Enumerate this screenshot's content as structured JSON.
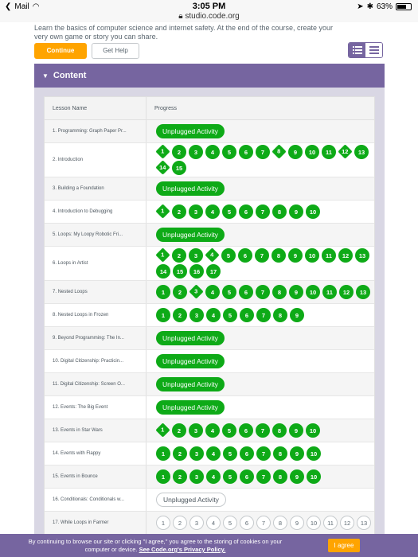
{
  "status_bar": {
    "back_label": "Mail",
    "time": "3:05 PM",
    "url": "studio.code.org",
    "battery": "63%"
  },
  "intro": {
    "description": "Learn the basics of computer science and internet safety. At the end of the course, create your very own game or story you can share."
  },
  "buttons": {
    "continue": "Continue",
    "help": "Get Help"
  },
  "section": {
    "title": "Content"
  },
  "table": {
    "col_name": "Lesson Name",
    "col_progress": "Progress",
    "rows": [
      {
        "name": "1. Programming: Graph Paper Pr...",
        "type": "pill",
        "label": "Unplugged Activity",
        "filled": true,
        "h": 29
      },
      {
        "name": "2. Introduction",
        "type": "levels",
        "levels": [
          "1",
          "2",
          "3",
          "4",
          "5",
          "6",
          "7",
          "8",
          "9",
          "10",
          "11",
          "12",
          "13",
          "14",
          "15"
        ],
        "diamonds": [
          0,
          7,
          11,
          13
        ],
        "filled": true,
        "h": 43
      },
      {
        "name": "3. Building a Foundation",
        "type": "pill",
        "label": "Unplugged Activity",
        "filled": true,
        "h": 29
      },
      {
        "name": "4. Introduction to Debugging",
        "type": "levels",
        "levels": [
          "1",
          "2",
          "3",
          "4",
          "5",
          "6",
          "7",
          "8",
          "9",
          "10"
        ],
        "diamonds": [
          0
        ],
        "filled": true,
        "h": 29
      },
      {
        "name": "5. Loops: My Loopy Robotic Fri...",
        "type": "pill",
        "label": "Unplugged Activity",
        "filled": true,
        "h": 29
      },
      {
        "name": "6. Loops in Artist",
        "type": "levels",
        "levels": [
          "1",
          "2",
          "3",
          "4",
          "5",
          "6",
          "7",
          "8",
          "9",
          "10",
          "11",
          "12",
          "13",
          "14",
          "15",
          "16",
          "17"
        ],
        "diamonds": [
          0,
          3
        ],
        "filled": true,
        "h": 43
      },
      {
        "name": "7. Nested Loops",
        "type": "levels",
        "levels": [
          "1",
          "2",
          "3",
          "4",
          "5",
          "6",
          "7",
          "8",
          "9",
          "10",
          "11",
          "12",
          "13"
        ],
        "diamonds": [
          2
        ],
        "filled": true,
        "h": 29
      },
      {
        "name": "8. Nested Loops in Frozen",
        "type": "levels",
        "levels": [
          "1",
          "2",
          "3",
          "4",
          "5",
          "6",
          "7",
          "8",
          "9"
        ],
        "diamonds": [],
        "filled": true,
        "h": 29
      },
      {
        "name": "9. Beyond Programming: The In...",
        "type": "pill",
        "label": "Unplugged Activity",
        "filled": true,
        "h": 29
      },
      {
        "name": "10. Digital Citizenship: Practicin...",
        "type": "pill",
        "label": "Unplugged Activity",
        "filled": true,
        "h": 29
      },
      {
        "name": "11. Digital Citizenship: Screen O...",
        "type": "pill",
        "label": "Unplugged Activity",
        "filled": true,
        "h": 29
      },
      {
        "name": "12. Events: The Big Event",
        "type": "pill",
        "label": "Unplugged Activity",
        "filled": true,
        "h": 29
      },
      {
        "name": "13. Events in Star Wars",
        "type": "levels",
        "levels": [
          "1",
          "2",
          "3",
          "4",
          "5",
          "6",
          "7",
          "8",
          "9",
          "10"
        ],
        "diamonds": [
          0
        ],
        "filled": true,
        "h": 29
      },
      {
        "name": "14. Events with Flappy",
        "type": "levels",
        "levels": [
          "1",
          "2",
          "3",
          "4",
          "5",
          "6",
          "7",
          "8",
          "9",
          "10"
        ],
        "diamonds": [],
        "filled": true,
        "h": 29
      },
      {
        "name": "15. Events in Bounce",
        "type": "levels",
        "levels": [
          "1",
          "2",
          "3",
          "4",
          "5",
          "6",
          "7",
          "8",
          "9",
          "10"
        ],
        "diamonds": [],
        "filled": true,
        "h": 29
      },
      {
        "name": "16. Conditionals: Conditionals w...",
        "type": "pill",
        "label": "Unplugged Activity",
        "filled": false,
        "h": 29
      },
      {
        "name": "17. While Loops in Farmer",
        "type": "levels",
        "levels": [
          "1",
          "2",
          "3",
          "4",
          "5",
          "6",
          "7",
          "8",
          "9",
          "10",
          "11",
          "12",
          "13"
        ],
        "diamonds": [],
        "filled": false,
        "h": 29
      }
    ]
  },
  "cookie": {
    "text_line1": "By continuing to browse our site or clicking \"I agree,\" you agree to the storing of cookies on your",
    "text_line2": "computer or device.",
    "link": "See Code.org's Privacy Policy.",
    "agree": "I agree"
  },
  "colors": {
    "purple": "#7665a0",
    "green": "#0eaa17",
    "orange": "#ffa400"
  }
}
